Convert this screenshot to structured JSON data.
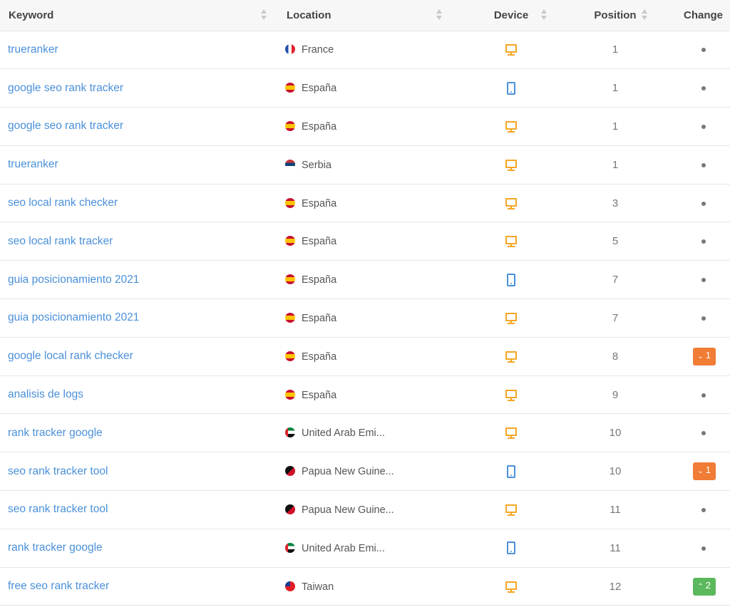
{
  "columns": {
    "keyword": "Keyword",
    "location": "Location",
    "device": "Device",
    "position": "Position",
    "change": "Change"
  },
  "colors": {
    "link": "#4a90d9",
    "desktop_icon": "#f5a623",
    "mobile_icon": "#4a90d9",
    "change_down": "#f07c35",
    "change_up": "#5cb85c"
  },
  "rows": [
    {
      "keyword": "trueranker",
      "flag": "france-flag-icon",
      "location": "France",
      "device": "desktop",
      "position": "1",
      "change": "",
      "change_dir": "none"
    },
    {
      "keyword": "google seo rank tracker",
      "flag": "spain-flag-icon",
      "location": "España",
      "device": "mobile",
      "position": "1",
      "change": "",
      "change_dir": "none"
    },
    {
      "keyword": "google seo rank tracker",
      "flag": "spain-flag-icon",
      "location": "España",
      "device": "desktop",
      "position": "1",
      "change": "",
      "change_dir": "none"
    },
    {
      "keyword": "trueranker",
      "flag": "serbia-flag-icon",
      "location": "Serbia",
      "device": "desktop",
      "position": "1",
      "change": "",
      "change_dir": "none"
    },
    {
      "keyword": "seo local rank checker",
      "flag": "spain-flag-icon",
      "location": "España",
      "device": "desktop",
      "position": "3",
      "change": "",
      "change_dir": "none"
    },
    {
      "keyword": "seo local rank tracker",
      "flag": "spain-flag-icon",
      "location": "España",
      "device": "desktop",
      "position": "5",
      "change": "",
      "change_dir": "none"
    },
    {
      "keyword": "guia posicionamiento 2021",
      "flag": "spain-flag-icon",
      "location": "España",
      "device": "mobile",
      "position": "7",
      "change": "",
      "change_dir": "none"
    },
    {
      "keyword": "guia posicionamiento 2021",
      "flag": "spain-flag-icon",
      "location": "España",
      "device": "desktop",
      "position": "7",
      "change": "",
      "change_dir": "none"
    },
    {
      "keyword": "google local rank checker",
      "flag": "spain-flag-icon",
      "location": "España",
      "device": "desktop",
      "position": "8",
      "change": "1",
      "change_dir": "down"
    },
    {
      "keyword": "analisis de logs",
      "flag": "spain-flag-icon",
      "location": "España",
      "device": "desktop",
      "position": "9",
      "change": "",
      "change_dir": "none"
    },
    {
      "keyword": "rank tracker google",
      "flag": "uae-flag-icon",
      "location": "United Arab Emi...",
      "device": "desktop",
      "position": "10",
      "change": "",
      "change_dir": "none"
    },
    {
      "keyword": "seo rank tracker tool",
      "flag": "png-flag-icon",
      "location": "Papua New Guine...",
      "device": "mobile",
      "position": "10",
      "change": "1",
      "change_dir": "down"
    },
    {
      "keyword": "seo rank tracker tool",
      "flag": "png-flag-icon",
      "location": "Papua New Guine...",
      "device": "desktop",
      "position": "11",
      "change": "",
      "change_dir": "none"
    },
    {
      "keyword": "rank tracker google",
      "flag": "uae-flag-icon",
      "location": "United Arab Emi...",
      "device": "mobile",
      "position": "11",
      "change": "",
      "change_dir": "none"
    },
    {
      "keyword": "free seo rank tracker",
      "flag": "taiwan-flag-icon",
      "location": "Taiwan",
      "device": "desktop",
      "position": "12",
      "change": "2",
      "change_dir": "up"
    }
  ]
}
